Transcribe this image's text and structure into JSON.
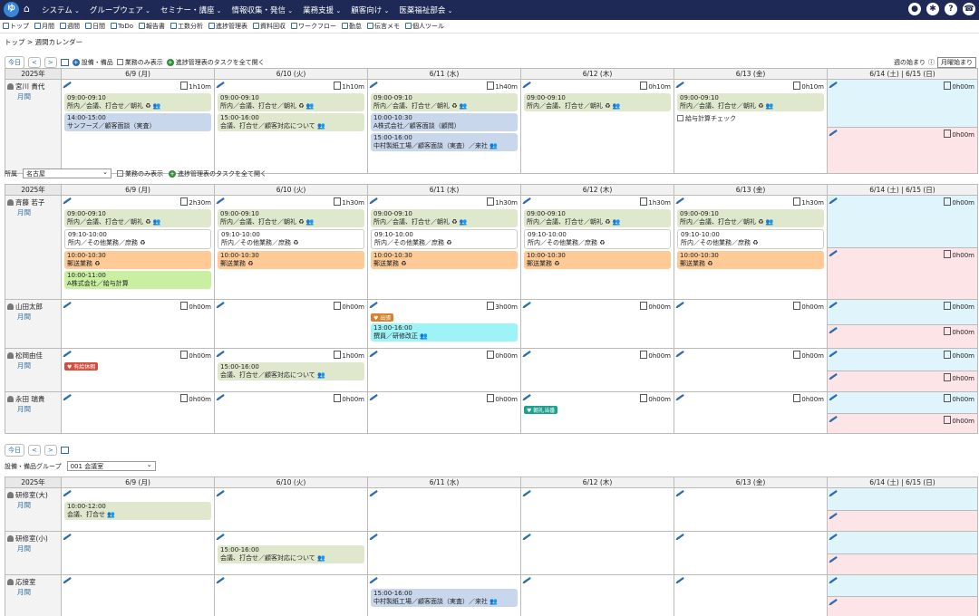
{
  "app": {
    "logo": "ゆ",
    "home_icon": "home-icon"
  },
  "menu": [
    "システム",
    "グループウェア",
    "セミナー・講座",
    "情報収集・発信",
    "業務支援",
    "顧客向け",
    "医薬福祉部会"
  ],
  "top_icons": [
    "user-icon",
    "gear-icon",
    "help-icon",
    "phone-icon"
  ],
  "toolbar": [
    "トップ",
    "月間",
    "週間",
    "日間",
    "ToDo",
    "報告書",
    "工数分析",
    "進捗管理表",
    "資料回収",
    "ワークフロー",
    "勤怠",
    "伝言メモ",
    "個人ツール"
  ],
  "breadcrumb": {
    "top": "トップ",
    "sep": ">",
    "current": "週間カレンダー"
  },
  "nav": {
    "today": "今日",
    "prev": "<",
    "next": ">"
  },
  "section1": {
    "add_facility": "設備・備品",
    "business_only": "業務のみ表示",
    "open_tasks": "進捗管理表のタスクを全て開く"
  },
  "week_start": {
    "label": "週の始まり",
    "value": "月曜始まり"
  },
  "days": [
    "6/9 (月)",
    "6/10 (火)",
    "6/11 (水)",
    "6/12 (木)",
    "6/13 (金)",
    "6/14 (土) | 6/15 (日)"
  ],
  "year": "2025年",
  "period_label": "月間",
  "table1": {
    "rows": [
      {
        "name": "宮川 貴代",
        "hours": [
          "1h10m",
          "1h10m",
          "1h40m",
          "0h10m",
          "0h10m"
        ],
        "we_hours": [
          "0h00m",
          "0h00m"
        ],
        "events": [
          [
            {
              "c": "green",
              "t": "09:00-09:10",
              "d": "所内／会議、打合せ／朝礼 ♻ 👥"
            },
            {
              "c": "blue",
              "t": "14:00-15:00",
              "d": "サンフーズ／顧客面談（実査）"
            }
          ],
          [
            {
              "c": "green",
              "t": "09:00-09:10",
              "d": "所内／会議、打合せ／朝礼 ♻ 👥"
            },
            {
              "c": "green",
              "t": "15:00-16:00",
              "d": "会議、打合せ／顧客対応について 👥"
            }
          ],
          [
            {
              "c": "green",
              "t": "09:00-09:10",
              "d": "所内／会議、打合せ／朝礼 ♻ 👥"
            },
            {
              "c": "blue",
              "t": "10:00-10:30",
              "d": "A株式会社／顧客面談（顧問）"
            },
            {
              "c": "blue",
              "t": "15:00-16:00",
              "d": "中村製紙工場／顧客面談（実査）／来社 👥"
            }
          ],
          [
            {
              "c": "green",
              "t": "09:00-09:10",
              "d": "所内／会議、打合せ／朝礼 ♻ 👥"
            }
          ],
          [
            {
              "c": "green",
              "t": "09:00-09:10",
              "d": "所内／会議、打合せ／朝礼 ♻ 👥"
            }
          ]
        ],
        "todo_fri": "給与計算チェック"
      }
    ]
  },
  "section2": {
    "dept_label": "所属",
    "dept_value": "名古屋",
    "business_only": "業務のみ表示",
    "open_tasks": "進捗管理表のタスクを全て開く"
  },
  "table2": {
    "rows": [
      {
        "name": "斉藤 若子",
        "hours": [
          "2h30m",
          "1h30m",
          "1h30m",
          "1h30m",
          "1h30m"
        ],
        "we_hours": [
          "0h00m",
          "0h00m"
        ],
        "events": [
          [
            {
              "c": "green",
              "t": "09:00-09:10",
              "d": "所内／会議、打合せ／朝礼 ♻ 👥"
            },
            {
              "c": "white",
              "t": "09:10-10:00",
              "d": "所内／その他業務／庶務 ♻"
            },
            {
              "c": "orange",
              "t": "10:00-10:30",
              "d": "郵送業務 ♻"
            },
            {
              "c": "lime",
              "t": "10:00-11:00",
              "d": "A株式会社／給与計算"
            }
          ],
          [
            {
              "c": "green",
              "t": "09:00-09:10",
              "d": "所内／会議、打合せ／朝礼 ♻ 👥"
            },
            {
              "c": "white",
              "t": "09:10-10:00",
              "d": "所内／その他業務／庶務 ♻"
            },
            {
              "c": "orange",
              "t": "10:00-10:30",
              "d": "郵送業務 ♻"
            }
          ],
          [
            {
              "c": "green",
              "t": "09:00-09:10",
              "d": "所内／会議、打合せ／朝礼 ♻ 👥"
            },
            {
              "c": "white",
              "t": "09:10-10:00",
              "d": "所内／その他業務／庶務 ♻"
            },
            {
              "c": "orange",
              "t": "10:00-10:30",
              "d": "郵送業務 ♻"
            }
          ],
          [
            {
              "c": "green",
              "t": "09:00-09:10",
              "d": "所内／会議、打合せ／朝礼 ♻ 👥"
            },
            {
              "c": "white",
              "t": "09:10-10:00",
              "d": "所内／その他業務／庶務 ♻"
            },
            {
              "c": "orange",
              "t": "10:00-10:30",
              "d": "郵送業務 ♻"
            }
          ],
          [
            {
              "c": "green",
              "t": "09:00-09:10",
              "d": "所内／会議、打合せ／朝礼 ♻ 👥"
            },
            {
              "c": "white",
              "t": "09:10-10:00",
              "d": "所内／その他業務／庶務 ♻"
            },
            {
              "c": "orange",
              "t": "10:00-10:30",
              "d": "郵送業務 ♻"
            }
          ]
        ]
      },
      {
        "name": "山田太郎",
        "hours": [
          "0h00m",
          "0h00m",
          "3h00m",
          "0h00m",
          "0h00m"
        ],
        "we_hours": [
          "0h00m",
          "0h00m"
        ],
        "tags": {
          "2": {
            "c": "orange",
            "t": "♥ 出張"
          }
        },
        "events": [
          [],
          [],
          [
            {
              "c": "cyan",
              "t": "13:00-16:00",
              "d": "撰員／研修改正 👥"
            }
          ],
          [],
          []
        ]
      },
      {
        "name": "松岡由佳",
        "hours": [
          "0h00m",
          "1h00m",
          "0h00m",
          "0h00m",
          "0h00m"
        ],
        "we_hours": [
          "0h00m",
          "0h00m"
        ],
        "tags": {
          "0": {
            "c": "red",
            "t": "♥ 有給休暇"
          }
        },
        "events": [
          [],
          [
            {
              "c": "green",
              "t": "15:00-16:00",
              "d": "会議、打合せ／顧客対応について 👥"
            }
          ],
          [],
          [],
          []
        ]
      },
      {
        "name": "永田 瑞貴",
        "hours": [
          "0h00m",
          "0h00m",
          "0h00m",
          "0h00m",
          "0h00m"
        ],
        "we_hours": [
          "0h00m",
          "0h00m"
        ],
        "tags": {
          "3": {
            "c": "teal",
            "t": "♥ 朝礼当番"
          }
        },
        "events": [
          [],
          [],
          [],
          [],
          []
        ]
      }
    ]
  },
  "section3": {
    "facility_group_label": "設備・備品グループ",
    "facility_group_value": "001 会議室"
  },
  "table3": {
    "rows": [
      {
        "name": "研修室(大)",
        "events": [
          [
            {
              "c": "green",
              "t": "10:00-12:00",
              "d": "会議、打合せ 👥"
            }
          ],
          [],
          [],
          [],
          []
        ]
      },
      {
        "name": "研修室(小)",
        "events": [
          [],
          [
            {
              "c": "green",
              "t": "15:00-16:00",
              "d": "会議、打合せ／顧客対応について 👥"
            }
          ],
          [],
          [],
          []
        ]
      },
      {
        "name": "応接室",
        "events": [
          [],
          [],
          [
            {
              "c": "blue",
              "t": "15:00-16:00",
              "d": "中村製紙工場／顧客面談（実査）／来社 👥"
            }
          ],
          [],
          []
        ]
      }
    ]
  }
}
